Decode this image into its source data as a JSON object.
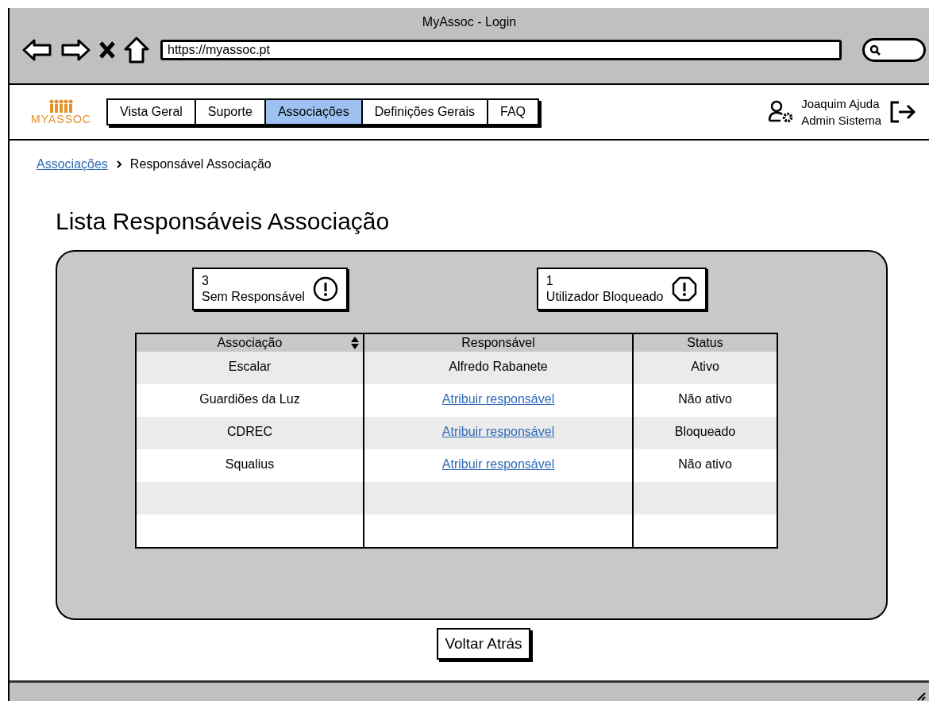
{
  "window": {
    "title": "MyAssoc - Login",
    "url": "https://myassoc.pt"
  },
  "logo": {
    "text": "MYASSOC"
  },
  "nav": [
    {
      "label": "Vista Geral",
      "selected": false
    },
    {
      "label": "Suporte",
      "selected": false
    },
    {
      "label": "Associações",
      "selected": true
    },
    {
      "label": "Definições Gerais",
      "selected": false
    },
    {
      "label": "FAQ",
      "selected": false
    }
  ],
  "user": {
    "name": "Joaquim Ajuda",
    "role": "Admin Sistema"
  },
  "breadcrumb": [
    {
      "label": "Associações",
      "kind": "link"
    },
    {
      "label": "Responsável Associação",
      "kind": "text"
    }
  ],
  "title": "Lista Responsáveis Associação",
  "cards": [
    {
      "count": "3",
      "label": "Sem Responsável",
      "kind": "circle"
    },
    {
      "count": "1",
      "label": "Utilizador Bloqueado",
      "kind": "octagon"
    }
  ],
  "table": {
    "columns": [
      "Associação",
      "Responsável",
      "Status"
    ],
    "rows": [
      [
        {
          "text": "Escalar",
          "kind": "text"
        },
        {
          "text": "Alfredo Rabanete",
          "kind": "text"
        },
        {
          "text": "Ativo",
          "kind": "text"
        }
      ],
      [
        {
          "text": "Guardiões da Luz",
          "kind": "text"
        },
        {
          "text": "Atribuir responsável",
          "kind": "link"
        },
        {
          "text": "Não ativo",
          "kind": "text"
        }
      ],
      [
        {
          "text": "CDREC",
          "kind": "text"
        },
        {
          "text": "Atribuir responsável",
          "kind": "link"
        },
        {
          "text": "Bloqueado",
          "kind": "text"
        }
      ],
      [
        {
          "text": "Squalius",
          "kind": "text"
        },
        {
          "text": "Atribuir responsável",
          "kind": "link"
        },
        {
          "text": "Não ativo",
          "kind": "text"
        }
      ]
    ]
  },
  "back_button": "Voltar Atrás"
}
